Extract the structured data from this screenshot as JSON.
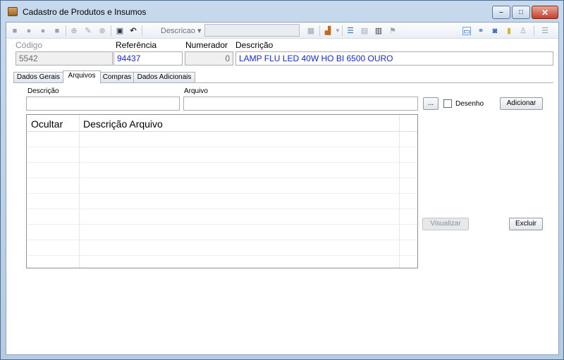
{
  "window": {
    "title": "Cadastro de Produtos e Insumos",
    "close_glyph": "✕",
    "min_glyph": "–",
    "max_glyph": "□"
  },
  "toolbar": {
    "search_label": "Descricao ▾",
    "search_value": ""
  },
  "header": {
    "codigo_label": "Código",
    "codigo_value": "5542",
    "referencia_label": "Referência",
    "referencia_value": "94437",
    "numerador_label": "Numerador",
    "numerador_value": "0",
    "descricao_label": "Descrição",
    "descricao_value": "LAMP FLU LED 40W HO BI 6500 OURO"
  },
  "tabs": [
    {
      "label": "Dados Gerais",
      "active": false
    },
    {
      "label": "Arquivos",
      "active": true
    },
    {
      "label": "Compras",
      "active": false
    },
    {
      "label": "Dados Adicionais",
      "active": false
    }
  ],
  "arquivos": {
    "descricao_label": "Descrição",
    "descricao_value": "",
    "arquivo_label": "Arquivo",
    "arquivo_value": "",
    "browse_label": "...",
    "desenho_label": "Desenho",
    "desenho_checked": false,
    "adicionar_label": "Adicionar",
    "visualizar_label": "Visualizar",
    "excluir_label": "Excluir",
    "grid": {
      "columns": [
        "Ocultar",
        "Descrição Arquivo"
      ],
      "rows": []
    }
  },
  "colors": {
    "accent_blue": "#1a2bc1",
    "close_red": "#c5402a"
  }
}
